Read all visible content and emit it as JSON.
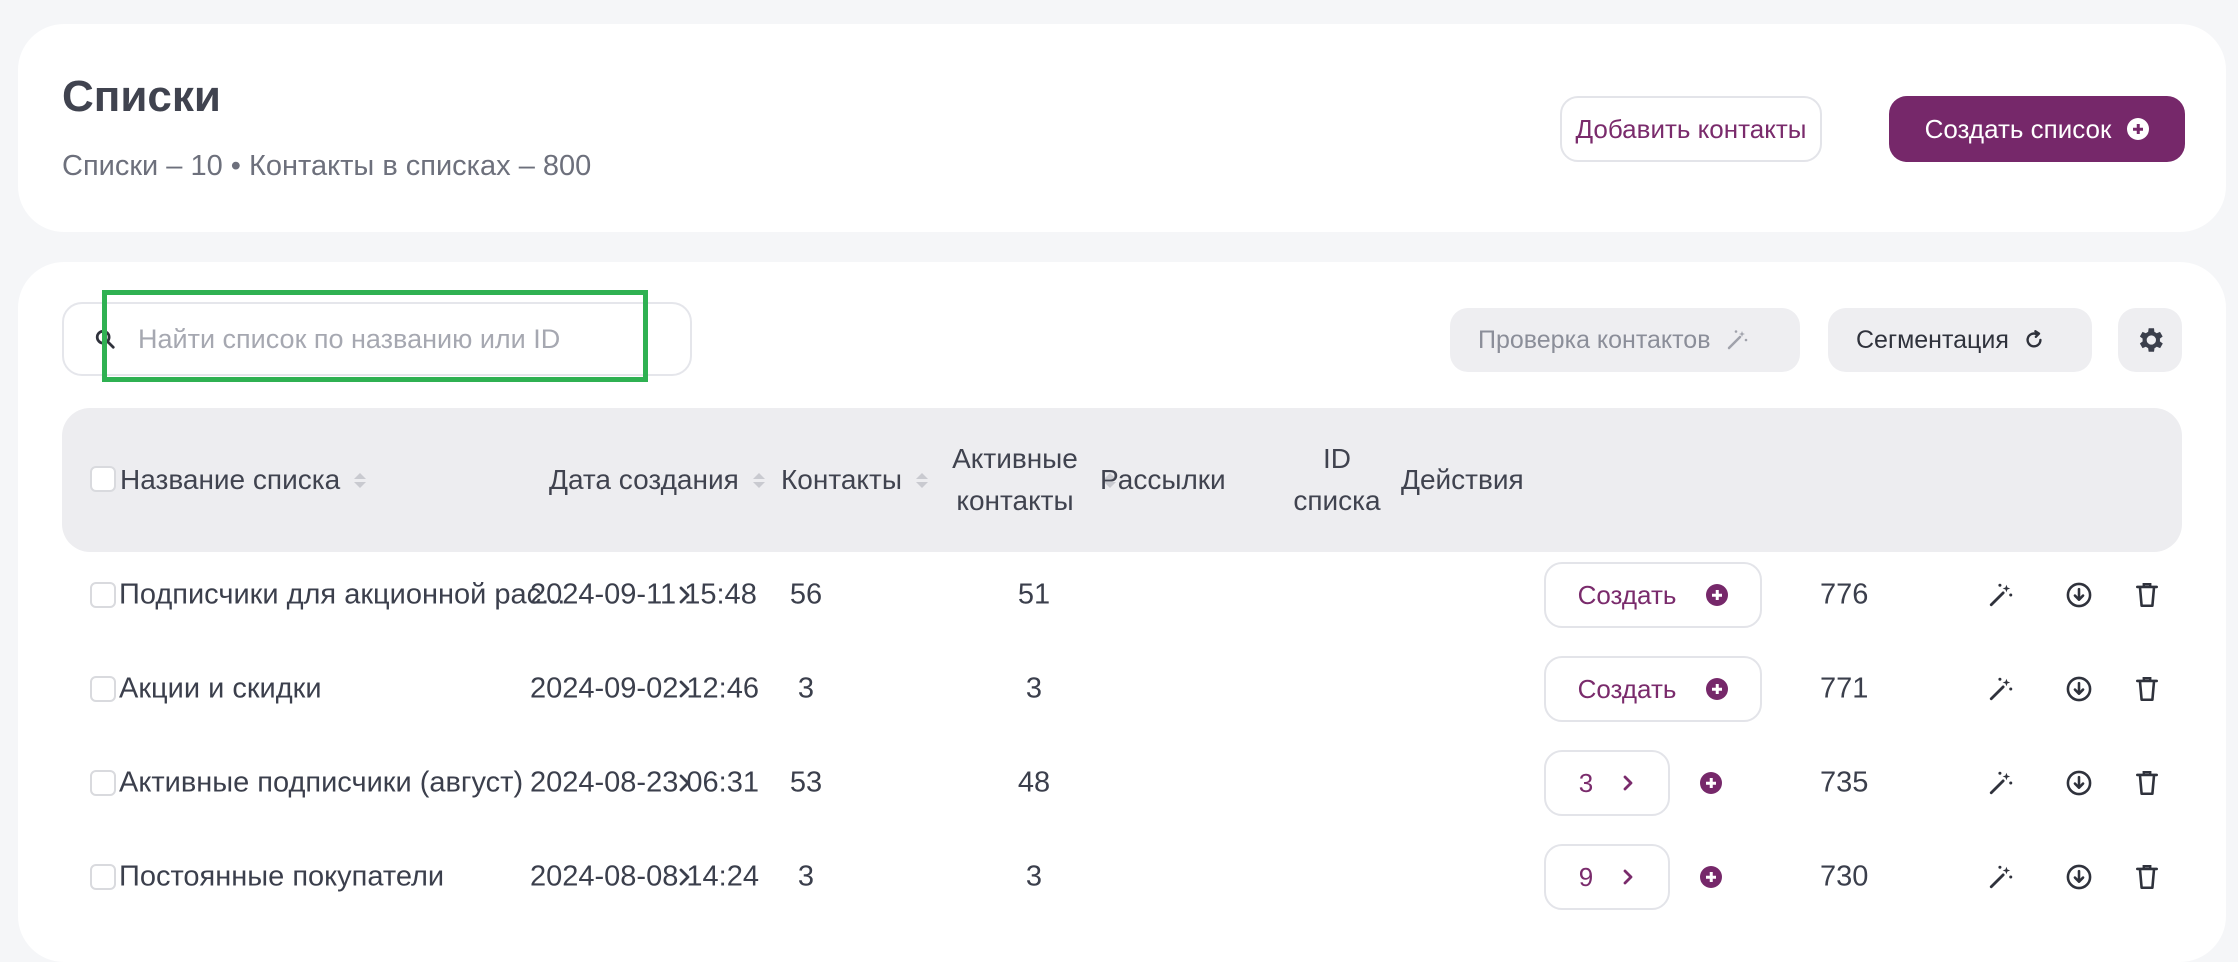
{
  "header": {
    "title": "Списки",
    "subtitle": "Списки – 10 • Контакты в списках – 800",
    "add_contacts_label": "Добавить контакты",
    "create_list_label": "Создать список"
  },
  "toolbar": {
    "search_placeholder": "Найти список по названию или ID",
    "check_contacts_label": "Проверка контактов",
    "segmentation_label": "Сегментация"
  },
  "table": {
    "columns": {
      "name": "Название списка",
      "date": "Дата создания",
      "contacts": "Контакты",
      "active": "Активные контакты",
      "campaigns": "Рассылки",
      "id": "ID списка",
      "actions": "Действия"
    },
    "create_label": "Создать",
    "rows": [
      {
        "name": "Подписчики для акционной рас...",
        "date": "2024-09-11 15:48",
        "contacts": "56",
        "active": "51",
        "campaigns": "",
        "id": "776"
      },
      {
        "name": "Акции и скидки",
        "date": "2024-09-02 12:46",
        "contacts": "3",
        "active": "3",
        "campaigns": "",
        "id": "771"
      },
      {
        "name": "Активные подписчики (август)",
        "date": "2024-08-23 06:31",
        "contacts": "53",
        "active": "48",
        "campaigns": "3",
        "id": "735"
      },
      {
        "name": "Постоянные покупатели",
        "date": "2024-08-08 14:24",
        "contacts": "3",
        "active": "3",
        "campaigns": "9",
        "id": "730"
      }
    ]
  },
  "colors": {
    "brand": "#76286a",
    "highlight": "#2fb152"
  },
  "icons": [
    "search-icon",
    "wand-icon",
    "refresh-icon",
    "gear-icon",
    "plus-circle-icon",
    "chevron-right-icon",
    "download-icon",
    "trash-icon"
  ]
}
